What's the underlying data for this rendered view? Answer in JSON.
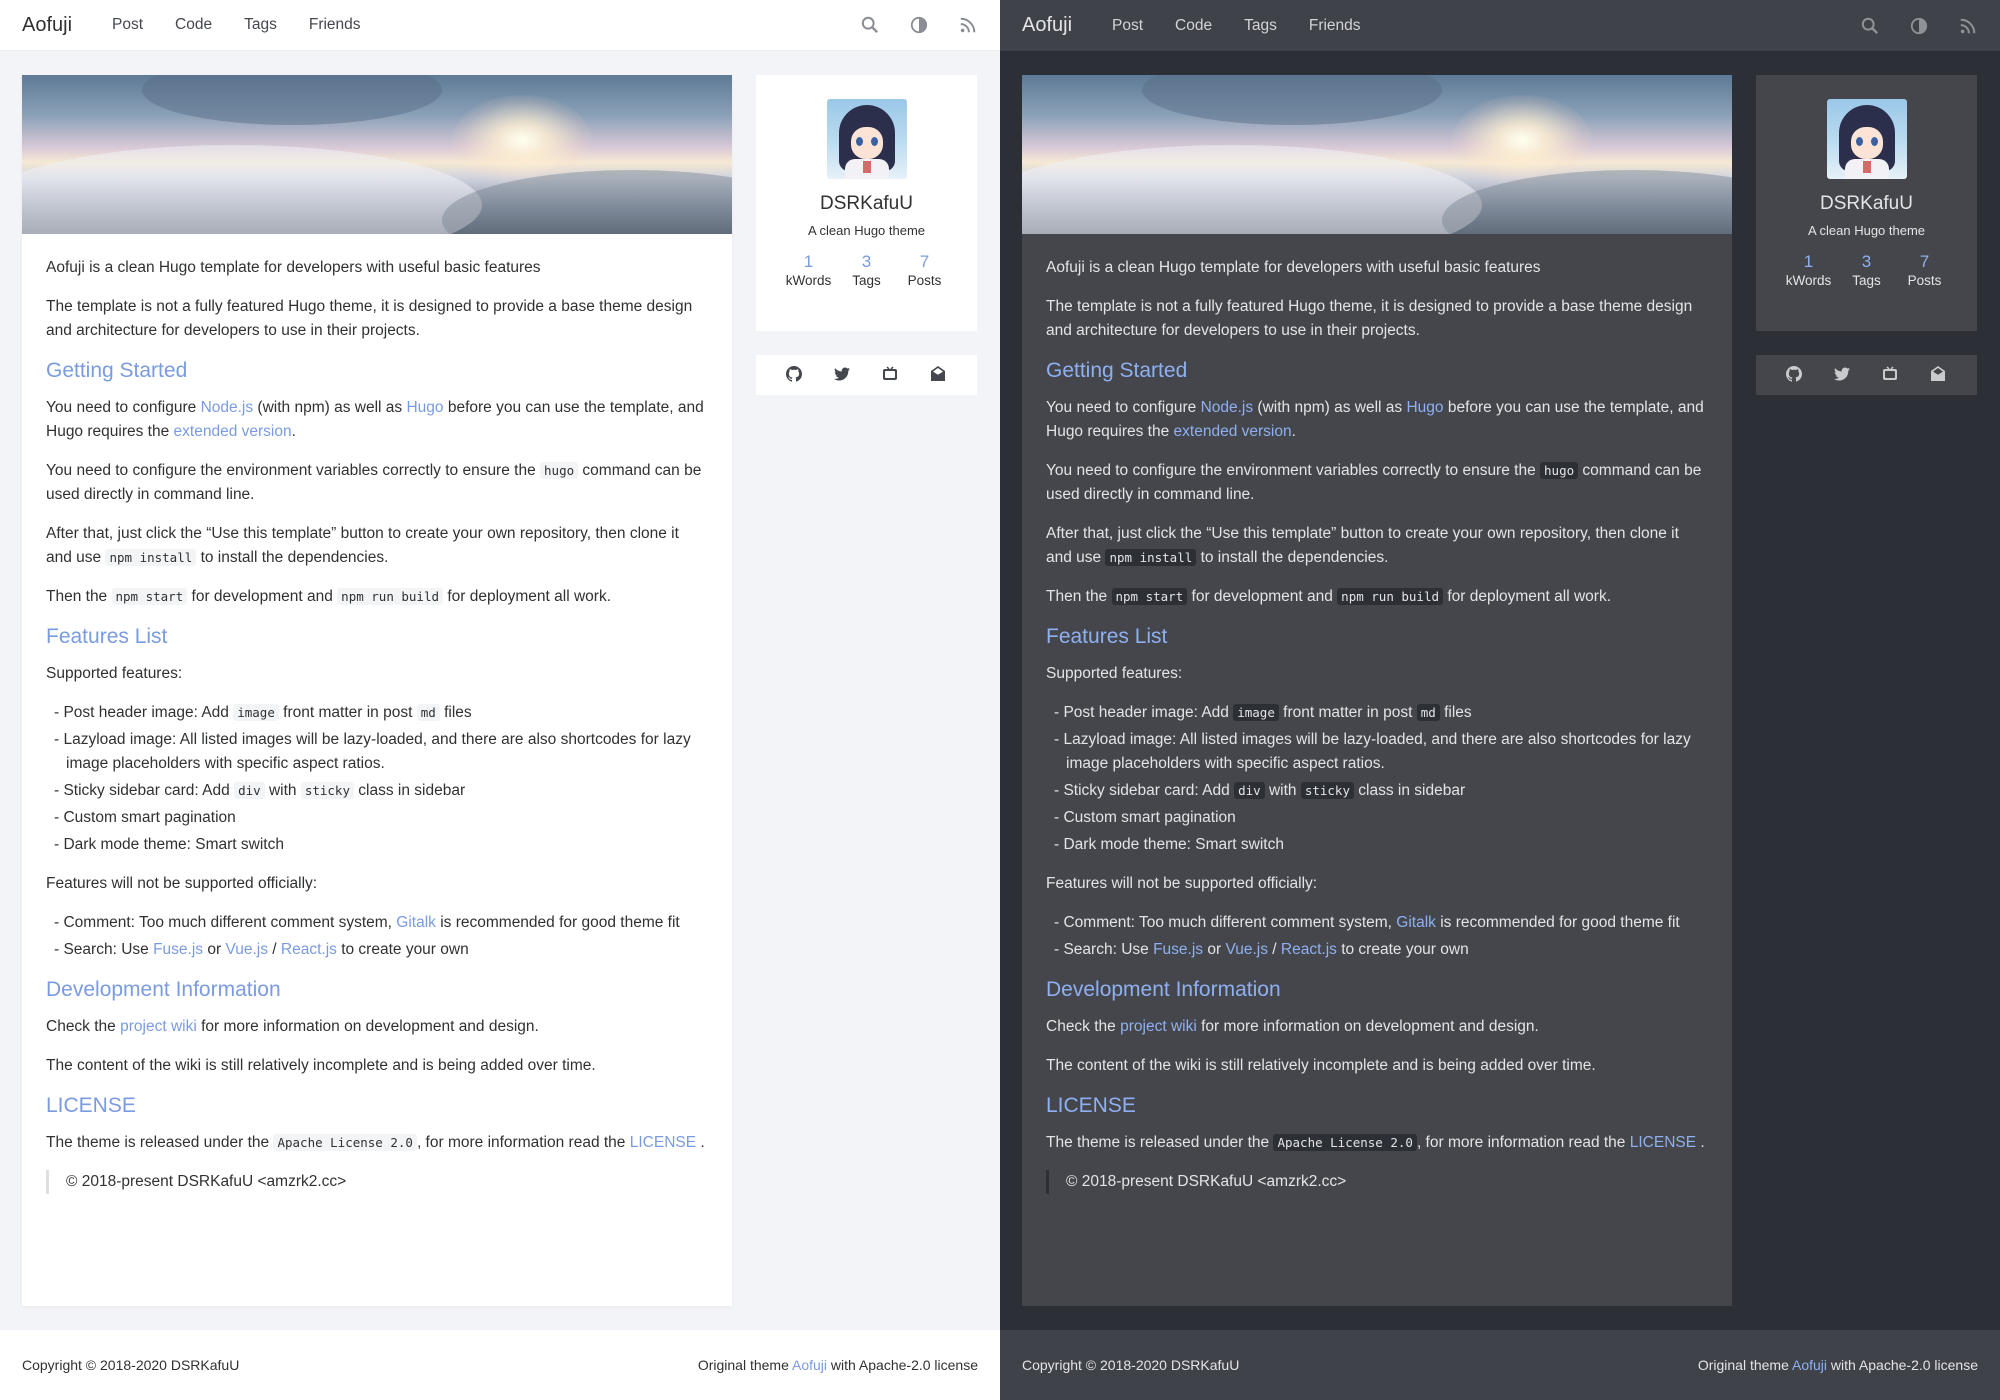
{
  "site": {
    "brand": "Aofuji",
    "nav": [
      "Post",
      "Code",
      "Tags",
      "Friends"
    ]
  },
  "nav_icons": [
    "search-icon",
    "contrast-icon",
    "rss-icon"
  ],
  "colors": {
    "accent": "#7a9be0",
    "light_bg": "#f3f4f7",
    "dark_bg": "#2c2f35",
    "dark_card": "#44464c"
  },
  "profile": {
    "name": "DSRKafuU",
    "desc": "A clean Hugo theme",
    "stats": [
      {
        "num": "1",
        "label": "kWords"
      },
      {
        "num": "3",
        "label": "Tags"
      },
      {
        "num": "7",
        "label": "Posts"
      }
    ]
  },
  "social_icons": [
    "github-icon",
    "twitter-icon",
    "bilibili-icon",
    "email-icon"
  ],
  "article": {
    "intro1": "Aofuji is a clean Hugo template for developers with useful basic features",
    "intro2": "The template is not a fully featured Hugo theme, it is designed to provide a base theme design and architecture for developers to use in their projects.",
    "h_getting_started": "Getting Started",
    "gs1_a": "You need to configure ",
    "gs1_link1": "Node.js",
    "gs1_b": " (with npm) as well as ",
    "gs1_link2": "Hugo",
    "gs1_c": " before you can use the template, and Hugo requires the ",
    "gs1_link3": "extended version",
    "gs1_d": ".",
    "gs2_a": "You need to configure the environment variables correctly to ensure the ",
    "gs2_code": "hugo",
    "gs2_b": " command can be used directly in command line.",
    "gs3_a": "After that, just click the “Use this template” button to create your own repository, then clone it and use ",
    "gs3_code": "npm install",
    "gs3_b": " to install the dependencies.",
    "gs4_a": "Then the ",
    "gs4_code1": "npm start",
    "gs4_b": " for development and ",
    "gs4_code2": "npm run build",
    "gs4_c": " for deployment all work.",
    "h_features": "Features List",
    "supported": "Supported features:",
    "f1_a": "Post header image: Add ",
    "f1_code1": "image",
    "f1_b": " front matter in post ",
    "f1_code2": "md",
    "f1_c": " files",
    "f2": "Lazyload image: All listed images will be lazy-loaded, and there are also shortcodes for lazy image placeholders with specific aspect ratios.",
    "f3_a": "Sticky sidebar card: Add ",
    "f3_code1": "div",
    "f3_b": " with ",
    "f3_code2": "sticky",
    "f3_c": " class in sidebar",
    "f4": "Custom smart pagination",
    "f5": "Dark mode theme: Smart switch",
    "not_supported": "Features will not be supported officially:",
    "n1_a": "Comment: Too much different comment system, ",
    "n1_link": "Gitalk",
    "n1_b": " is recommended for good theme fit",
    "n2_a": "Search: Use ",
    "n2_link1": "Fuse.js",
    "n2_b": " or ",
    "n2_link2": "Vue.js",
    "n2_c": " / ",
    "n2_link3": "React.js",
    "n2_d": " to create your own",
    "h_dev": "Development Information",
    "dev1_a": "Check the ",
    "dev1_link": "project wiki",
    "dev1_b": " for more information on development and design.",
    "dev2": "The content of the wiki is still relatively incomplete and is being added over time.",
    "h_license": "LICENSE",
    "lic_a": "The theme is released under the ",
    "lic_code": "Apache License 2.0",
    "lic_b": ", for more information read the ",
    "lic_link": "LICENSE",
    "lic_c": " .",
    "quote": "© 2018-present DSRKafuU <amzrk2.cc>"
  },
  "footer": {
    "copyright": "Copyright © 2018-2020 DSRKafuU",
    "right_a": "Original theme ",
    "right_link": "Aofuji",
    "right_b": " with Apache-2.0 license"
  }
}
